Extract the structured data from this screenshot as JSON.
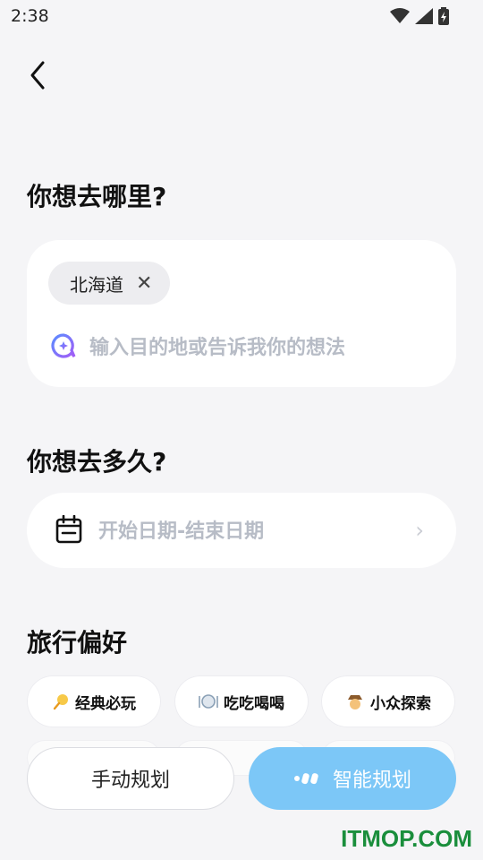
{
  "status": {
    "time": "2:38"
  },
  "sections": {
    "where": "你想去哪里?",
    "how_long": "你想去多久?",
    "preferences": "旅行偏好"
  },
  "destination": {
    "chip_label": "北海道",
    "chip_close": "✕",
    "placeholder": "输入目的地或告诉我你的想法"
  },
  "dates": {
    "placeholder": "开始日期-结束日期"
  },
  "preferences": [
    {
      "label": "经典必玩",
      "icon": "pin-icon"
    },
    {
      "label": "吃吃喝喝",
      "icon": "plate-icon"
    },
    {
      "label": "小众探索",
      "icon": "explorer-icon"
    }
  ],
  "buttons": {
    "manual": "手动规划",
    "smart": "智能规划"
  },
  "watermark": "ITMOP.COM",
  "colors": {
    "accent": "#7cc7f7",
    "purple": "#8a5cf6",
    "watermark": "#1a8e3c"
  }
}
